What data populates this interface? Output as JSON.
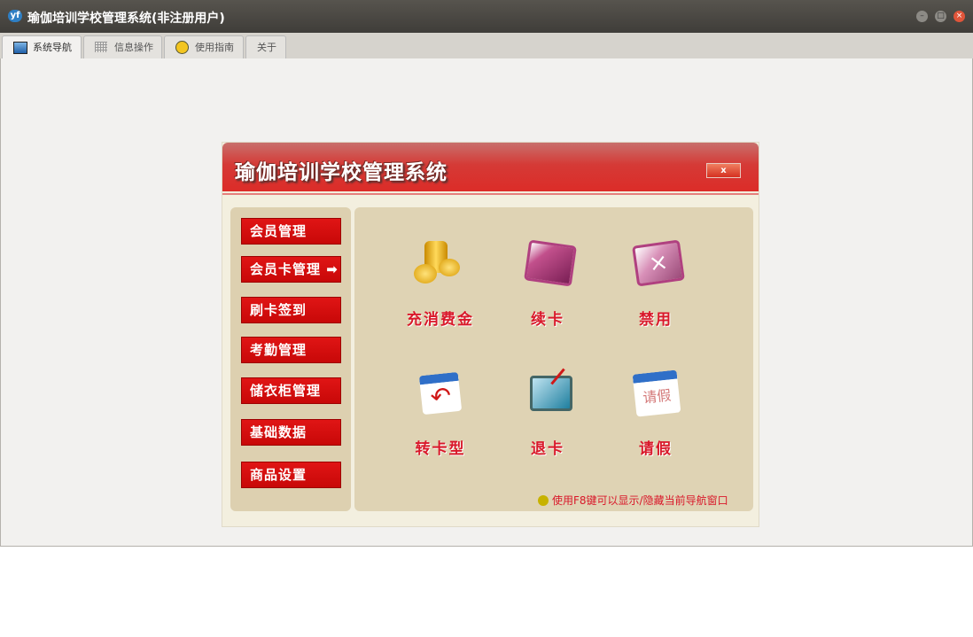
{
  "window": {
    "title": "瑜伽培训学校管理系统(非注册用户)",
    "minimize": "–",
    "maximize": "□",
    "close": "×"
  },
  "tabs": [
    {
      "label": "系统导航"
    },
    {
      "label": "信息操作"
    },
    {
      "label": "使用指南"
    },
    {
      "label": "关于"
    }
  ],
  "panel": {
    "title": "瑜伽培训学校管理系统",
    "close_label": "x",
    "nav": [
      {
        "label": "会员管理"
      },
      {
        "label": "会员卡管理 ➡"
      },
      {
        "label": "刷卡签到"
      },
      {
        "label": "考勤管理"
      },
      {
        "label": "储衣柜管理"
      },
      {
        "label": "基础数据"
      },
      {
        "label": "商品设置"
      }
    ],
    "actions": [
      {
        "label": "充消费金",
        "icon": "coins-icon"
      },
      {
        "label": "续卡",
        "icon": "card-icon"
      },
      {
        "label": "禁用",
        "icon": "card-disabled-icon"
      },
      {
        "label": "转卡型",
        "icon": "calendar-arrow-icon"
      },
      {
        "label": "退卡",
        "icon": "card-return-icon"
      },
      {
        "label": "请假",
        "icon": "leave-calendar-icon"
      }
    ],
    "leave_icon_text": "请假",
    "hint": "使用F8键可以显示/隐藏当前导航窗口"
  }
}
